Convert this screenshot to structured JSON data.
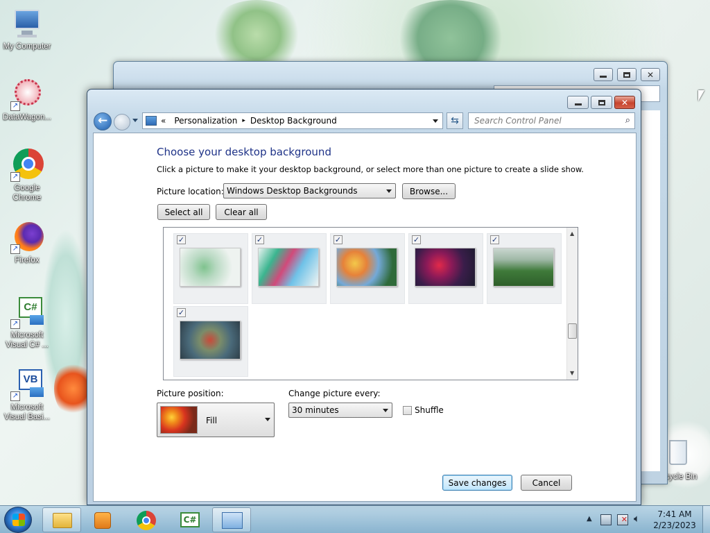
{
  "desktop": {
    "icons": [
      {
        "label": "My Computer"
      },
      {
        "label": "DataWagon..."
      },
      {
        "label": "Google Chrome"
      },
      {
        "label": "Firefox"
      },
      {
        "label": "Microsoft Visual C# ..."
      },
      {
        "label": "Microsoft Visual Basi..."
      },
      {
        "label": "Recycle Bin"
      }
    ]
  },
  "window": {
    "breadcrumb": {
      "root_glyph": "«",
      "items": [
        "Personalization",
        "Desktop Background"
      ],
      "separator": "▸"
    },
    "search_placeholder": "Search Control Panel",
    "heading": "Choose your desktop background",
    "description": "Click a picture to make it your desktop background, or select more than one picture to create a slide show.",
    "picture_location_label": "Picture location:",
    "picture_location_value": "Windows Desktop Backgrounds",
    "browse_label": "Browse...",
    "select_all_label": "Select all",
    "clear_all_label": "Clear all",
    "thumbnails": [
      {
        "checked": true,
        "name": "thumb-1"
      },
      {
        "checked": true,
        "name": "thumb-2"
      },
      {
        "checked": true,
        "name": "thumb-3"
      },
      {
        "checked": true,
        "name": "thumb-4"
      },
      {
        "checked": true,
        "name": "thumb-5"
      },
      {
        "checked": true,
        "name": "thumb-6"
      }
    ],
    "picture_position_label": "Picture position:",
    "picture_position_value": "Fill",
    "change_picture_label": "Change picture every:",
    "change_picture_value": "30 minutes",
    "shuffle_label": "Shuffle",
    "shuffle_checked": false,
    "save_label": "Save changes",
    "cancel_label": "Cancel"
  },
  "taskbar": {
    "time": "7:41 AM",
    "date": "2/23/2023"
  }
}
